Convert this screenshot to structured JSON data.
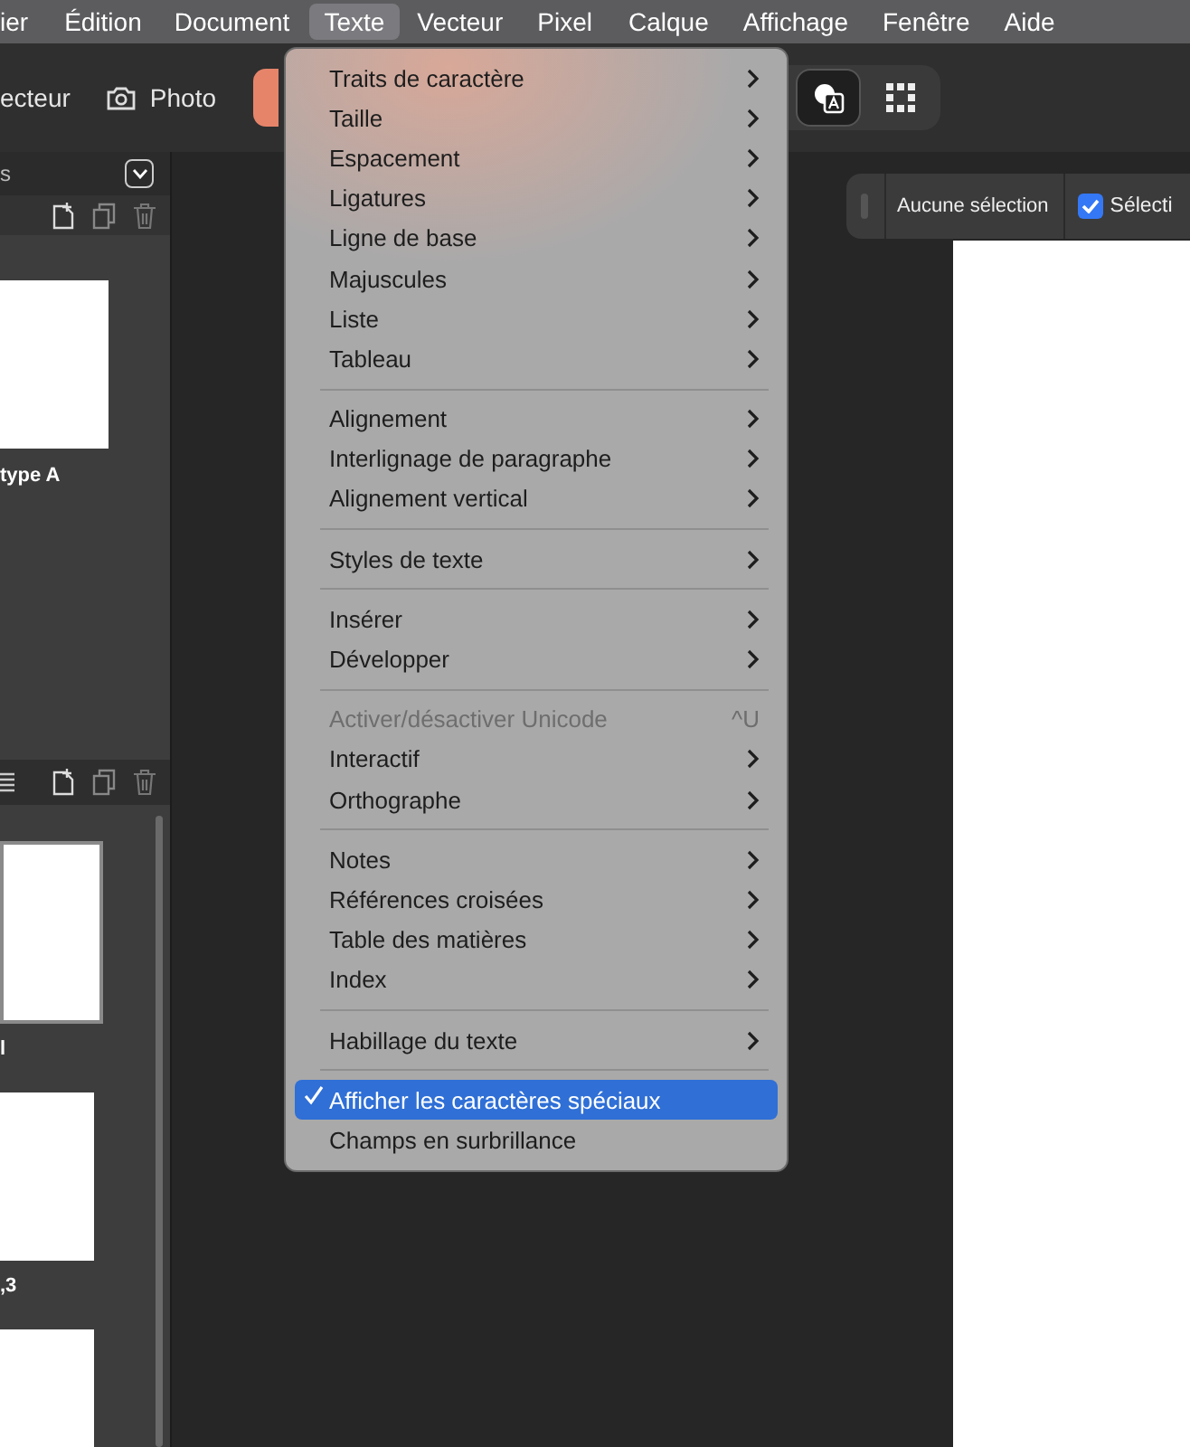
{
  "menu_bar": [
    {
      "label": "ier",
      "selected": false
    },
    {
      "label": "Édition",
      "selected": false
    },
    {
      "label": "Document",
      "selected": false
    },
    {
      "label": "Texte",
      "selected": true
    },
    {
      "label": "Vecteur",
      "selected": false
    },
    {
      "label": "Pixel",
      "selected": false
    },
    {
      "label": "Calque",
      "selected": false
    },
    {
      "label": "Affichage",
      "selected": false
    },
    {
      "label": "Fenêtre",
      "selected": false
    },
    {
      "label": "Aide",
      "selected": false
    }
  ],
  "toolbar": {
    "personas": [
      {
        "label": "ecteur",
        "kind": "text"
      },
      {
        "label": "Photo",
        "kind": "camera"
      }
    ]
  },
  "left_panel": {
    "header": "s",
    "upper_pages": [
      {
        "label": "type A",
        "selected": false
      }
    ],
    "lower_pages": [
      {
        "label": "l",
        "selected": true
      },
      {
        "label": ",3",
        "selected": false
      },
      {
        "selected": false
      }
    ]
  },
  "context_bar": {
    "label": "Aucune sélection",
    "checkbox": {
      "label": "Sélecti",
      "checked": true
    }
  },
  "text_menu": {
    "groups": [
      [
        {
          "label": "Traits de caractère",
          "submenu": true
        },
        {
          "label": "Taille",
          "submenu": true
        },
        {
          "label": "Espacement",
          "submenu": true
        },
        {
          "label": "Ligatures",
          "submenu": true
        },
        {
          "label": "Ligne de base",
          "submenu": true
        },
        {
          "label": "Majuscules",
          "submenu": true
        },
        {
          "label": "Liste",
          "submenu": true
        },
        {
          "label": "Tableau",
          "submenu": true
        }
      ],
      [
        {
          "label": "Alignement",
          "submenu": true
        },
        {
          "label": "Interlignage de paragraphe",
          "submenu": true
        },
        {
          "label": "Alignement vertical",
          "submenu": true
        }
      ],
      [
        {
          "label": "Styles de texte",
          "submenu": true
        }
      ],
      [
        {
          "label": "Insérer",
          "submenu": true
        },
        {
          "label": "Développer",
          "submenu": true
        }
      ],
      [
        {
          "label": "Activer/désactiver Unicode",
          "disabled": true,
          "shortcut": "^U"
        },
        {
          "label": "Interactif",
          "submenu": true
        },
        {
          "label": "Orthographe",
          "submenu": true
        }
      ],
      [
        {
          "label": "Notes",
          "submenu": true
        },
        {
          "label": "Références croisées",
          "submenu": true
        },
        {
          "label": "Table des matières",
          "submenu": true
        },
        {
          "label": "Index",
          "submenu": true
        }
      ],
      [
        {
          "label": "Habillage du texte",
          "submenu": true
        }
      ],
      [
        {
          "label": "Afficher les caractères spéciaux",
          "checked": true,
          "selected": true
        },
        {
          "label": "Champs en surbrillance",
          "checked": false,
          "selected": false
        }
      ]
    ]
  }
}
